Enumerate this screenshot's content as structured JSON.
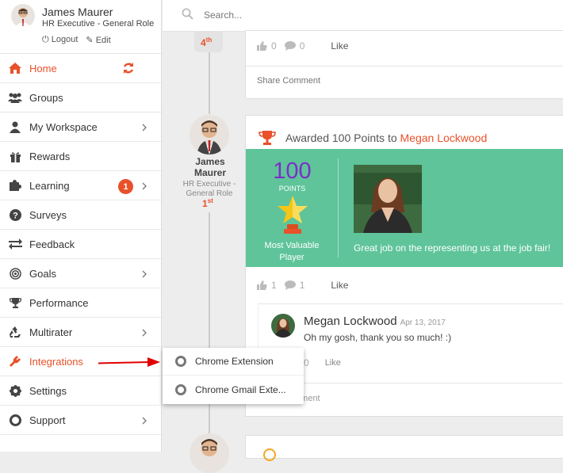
{
  "profile": {
    "name": "James Maurer",
    "role": "HR Executive - General Role",
    "logout": "Logout",
    "edit": "Edit"
  },
  "nav": [
    {
      "label": "Home",
      "icon": "home-icon"
    },
    {
      "label": "Groups",
      "icon": "users-icon"
    },
    {
      "label": "My Workspace",
      "icon": "user-icon"
    },
    {
      "label": "Rewards",
      "icon": "gift-icon"
    },
    {
      "label": "Learning",
      "icon": "puzzle-icon",
      "badge": "1"
    },
    {
      "label": "Surveys",
      "icon": "question-icon"
    },
    {
      "label": "Feedback",
      "icon": "exchange-icon"
    },
    {
      "label": "Goals",
      "icon": "target-icon"
    },
    {
      "label": "Performance",
      "icon": "trophy-icon"
    },
    {
      "label": "Multirater",
      "icon": "recycle-icon"
    },
    {
      "label": "Integrations",
      "icon": "plug-icon"
    },
    {
      "label": "Settings",
      "icon": "gear-icon"
    },
    {
      "label": "Support",
      "icon": "lifebuoy-icon"
    }
  ],
  "search": {
    "placeholder": "Search..."
  },
  "post1": {
    "rank": "4",
    "rank_suffix": "th",
    "likes": "0",
    "comments": "0",
    "like_label": "Like",
    "share_placeholder": "Share Comment"
  },
  "post2": {
    "author_first": "James",
    "author_last": "Maurer",
    "author_role": "HR Executive - General Role",
    "rank": "1",
    "rank_suffix": "st",
    "header_prefix": "Awarded 100 Points to",
    "recipient": "Megan Lockwood",
    "points": "100",
    "points_label": "POINTS",
    "award_name": "Most Valuable Player",
    "message": "Great job on the representing us at the job fair!",
    "likes": "1",
    "comments": "1",
    "like_label": "Like",
    "comment": {
      "author": "Megan Lockwood",
      "date": "Apr 13, 2017",
      "text": "Oh my gosh, thank you so much! :)",
      "likes": "0",
      "like_label": "Like"
    },
    "comment_placeholder_tail": "mment"
  },
  "integrations_menu": [
    {
      "label": "Chrome Extension"
    },
    {
      "label": "Chrome Gmail Exte..."
    }
  ],
  "colors": {
    "accent": "#e8512a",
    "green": "#5fc49a",
    "arrow": "#e00000",
    "purple": "#7b2fc8"
  }
}
